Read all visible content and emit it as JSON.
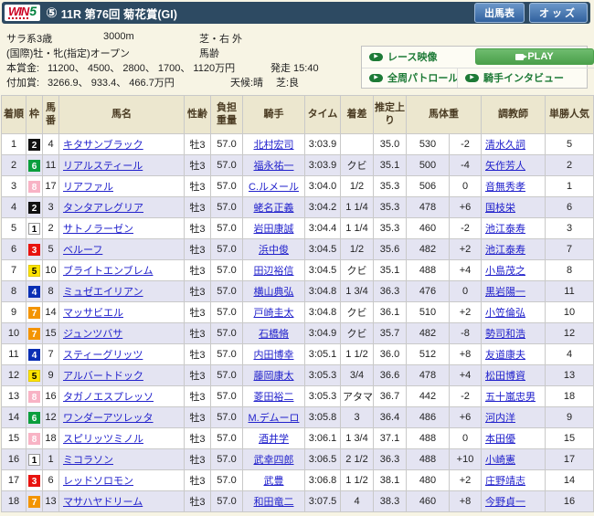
{
  "header": {
    "win5_w": "WIN",
    "win5_5": "5",
    "race_badge": "⑤",
    "title": "11R 第76回 菊花賞(GI)",
    "entries_button": "出馬表",
    "odds_button": "オッズ"
  },
  "race_info": {
    "class": "サラ系3歳",
    "distance": "3000m",
    "course": "芝・右 外",
    "conditions": "(国際)牡・牝(指定)オープン",
    "age_rule": "馬齢",
    "prize_label": "本賞金:",
    "prize_values": "11200、 4500、 2800、 1700、 1120万円",
    "start_time": "発走 15:40",
    "added_label": "付加賞:",
    "added_values": "3266.9、 933.4、 466.7万円",
    "weather": "天候:晴",
    "turf_condition": "芝:良"
  },
  "media": {
    "race_video_label": "レース映像",
    "play_label": "PLAY",
    "patrol_label": "全周パトロール",
    "interview_label": "騎手インタビュー",
    "link_green": "#1d7a36",
    "play_green": "#4ba04b"
  },
  "table": {
    "headers": {
      "rank": "着順",
      "frame": "枠",
      "number": "馬番",
      "name": "馬名",
      "sex_age": "性齢",
      "load": "負担重量",
      "jockey": "騎手",
      "time": "タイム",
      "margin": "着差",
      "last3f": "推定上り",
      "horse_weight": "馬体重",
      "trainer": "調教師",
      "popularity": "単勝人気"
    },
    "rows": [
      {
        "rank": "1",
        "frame": "2",
        "number": "4",
        "name": "キタサンブラック",
        "sex_age": "牡3",
        "load": "57.0",
        "jockey": "北村宏司",
        "time": "3:03.9",
        "margin": "",
        "last3f": "35.0",
        "horse_weight": "530",
        "weight_diff": "-2",
        "trainer": "清水久詞",
        "popularity": "5"
      },
      {
        "rank": "2",
        "frame": "6",
        "number": "11",
        "name": "リアルスティール",
        "sex_age": "牡3",
        "load": "57.0",
        "jockey": "福永祐一",
        "time": "3:03.9",
        "margin": "クビ",
        "last3f": "35.1",
        "horse_weight": "500",
        "weight_diff": "-4",
        "trainer": "矢作芳人",
        "popularity": "2"
      },
      {
        "rank": "3",
        "frame": "8",
        "number": "17",
        "name": "リアファル",
        "sex_age": "牡3",
        "load": "57.0",
        "jockey": "C.ルメール",
        "time": "3:04.0",
        "margin": "1/2",
        "last3f": "35.3",
        "horse_weight": "506",
        "weight_diff": "0",
        "trainer": "音無秀孝",
        "popularity": "1"
      },
      {
        "rank": "4",
        "frame": "2",
        "number": "3",
        "name": "タンタアレグリア",
        "sex_age": "牡3",
        "load": "57.0",
        "jockey": "蛯名正義",
        "time": "3:04.2",
        "margin": "1 1/4",
        "last3f": "35.3",
        "horse_weight": "478",
        "weight_diff": "+6",
        "trainer": "国枝栄",
        "popularity": "6"
      },
      {
        "rank": "5",
        "frame": "1",
        "number": "2",
        "name": "サトノラーゼン",
        "sex_age": "牡3",
        "load": "57.0",
        "jockey": "岩田康誠",
        "time": "3:04.4",
        "margin": "1 1/4",
        "last3f": "35.3",
        "horse_weight": "460",
        "weight_diff": "-2",
        "trainer": "池江泰寿",
        "popularity": "3"
      },
      {
        "rank": "6",
        "frame": "3",
        "number": "5",
        "name": "ベルーフ",
        "sex_age": "牡3",
        "load": "57.0",
        "jockey": "浜中俊",
        "time": "3:04.5",
        "margin": "1/2",
        "last3f": "35.6",
        "horse_weight": "482",
        "weight_diff": "+2",
        "trainer": "池江泰寿",
        "popularity": "7"
      },
      {
        "rank": "7",
        "frame": "5",
        "number": "10",
        "name": "ブライトエンブレム",
        "sex_age": "牡3",
        "load": "57.0",
        "jockey": "田辺裕信",
        "time": "3:04.5",
        "margin": "クビ",
        "last3f": "35.1",
        "horse_weight": "488",
        "weight_diff": "+4",
        "trainer": "小島茂之",
        "popularity": "8"
      },
      {
        "rank": "8",
        "frame": "4",
        "number": "8",
        "name": "ミュゼエイリアン",
        "sex_age": "牡3",
        "load": "57.0",
        "jockey": "横山典弘",
        "time": "3:04.8",
        "margin": "1 3/4",
        "last3f": "36.3",
        "horse_weight": "476",
        "weight_diff": "0",
        "trainer": "黒岩陽一",
        "popularity": "11"
      },
      {
        "rank": "9",
        "frame": "7",
        "number": "14",
        "name": "マッサビエル",
        "sex_age": "牡3",
        "load": "57.0",
        "jockey": "戸崎圭太",
        "time": "3:04.8",
        "margin": "クビ",
        "last3f": "36.1",
        "horse_weight": "510",
        "weight_diff": "+2",
        "trainer": "小笠倫弘",
        "popularity": "10"
      },
      {
        "rank": "10",
        "frame": "7",
        "number": "15",
        "name": "ジュンツバサ",
        "sex_age": "牡3",
        "load": "57.0",
        "jockey": "石橋脩",
        "time": "3:04.9",
        "margin": "クビ",
        "last3f": "35.7",
        "horse_weight": "482",
        "weight_diff": "-8",
        "trainer": "勢司和浩",
        "popularity": "12"
      },
      {
        "rank": "11",
        "frame": "4",
        "number": "7",
        "name": "スティーグリッツ",
        "sex_age": "牡3",
        "load": "57.0",
        "jockey": "内田博幸",
        "time": "3:05.1",
        "margin": "1 1/2",
        "last3f": "36.0",
        "horse_weight": "512",
        "weight_diff": "+8",
        "trainer": "友道康夫",
        "popularity": "4"
      },
      {
        "rank": "12",
        "frame": "5",
        "number": "9",
        "name": "アルバートドック",
        "sex_age": "牡3",
        "load": "57.0",
        "jockey": "藤岡康太",
        "time": "3:05.3",
        "margin": "3/4",
        "last3f": "36.6",
        "horse_weight": "478",
        "weight_diff": "+4",
        "trainer": "松田博資",
        "popularity": "13"
      },
      {
        "rank": "13",
        "frame": "8",
        "number": "16",
        "name": "タガノエスプレッソ",
        "sex_age": "牡3",
        "load": "57.0",
        "jockey": "菱田裕二",
        "time": "3:05.3",
        "margin": "アタマ",
        "last3f": "36.7",
        "horse_weight": "442",
        "weight_diff": "-2",
        "trainer": "五十嵐忠男",
        "popularity": "18"
      },
      {
        "rank": "14",
        "frame": "6",
        "number": "12",
        "name": "ワンダーアツレッタ",
        "sex_age": "牡3",
        "load": "57.0",
        "jockey": "M.デムーロ",
        "time": "3:05.8",
        "margin": "3",
        "last3f": "36.4",
        "horse_weight": "486",
        "weight_diff": "+6",
        "trainer": "河内洋",
        "popularity": "9"
      },
      {
        "rank": "15",
        "frame": "8",
        "number": "18",
        "name": "スピリッツミノル",
        "sex_age": "牡3",
        "load": "57.0",
        "jockey": "酒井学",
        "time": "3:06.1",
        "margin": "1 3/4",
        "last3f": "37.1",
        "horse_weight": "488",
        "weight_diff": "0",
        "trainer": "本田優",
        "popularity": "15"
      },
      {
        "rank": "16",
        "frame": "1",
        "number": "1",
        "name": "ミコラソン",
        "sex_age": "牡3",
        "load": "57.0",
        "jockey": "武幸四郎",
        "time": "3:06.5",
        "margin": "2 1/2",
        "last3f": "36.3",
        "horse_weight": "488",
        "weight_diff": "+10",
        "trainer": "小崎憲",
        "popularity": "17"
      },
      {
        "rank": "17",
        "frame": "3",
        "number": "6",
        "name": "レッドソロモン",
        "sex_age": "牡3",
        "load": "57.0",
        "jockey": "武豊",
        "time": "3:06.8",
        "margin": "1 1/2",
        "last3f": "38.1",
        "horse_weight": "480",
        "weight_diff": "+2",
        "trainer": "庄野靖志",
        "popularity": "14"
      },
      {
        "rank": "18",
        "frame": "7",
        "number": "13",
        "name": "マサハヤドリーム",
        "sex_age": "牡3",
        "load": "57.0",
        "jockey": "和田竜二",
        "time": "3:07.5",
        "margin": "4",
        "last3f": "38.3",
        "horse_weight": "460",
        "weight_diff": "+8",
        "trainer": "今野貞一",
        "popularity": "16"
      }
    ]
  },
  "frame_colors": {
    "1": {
      "bg": "#ffffff",
      "fg": "#000000",
      "border": "#999999"
    },
    "2": {
      "bg": "#111111",
      "fg": "#ffffff",
      "border": "#111111"
    },
    "3": {
      "bg": "#e8120e",
      "fg": "#ffffff",
      "border": "#e8120e"
    },
    "4": {
      "bg": "#0a2fb4",
      "fg": "#ffffff",
      "border": "#0a2fb4"
    },
    "5": {
      "bg": "#ffe400",
      "fg": "#000000",
      "border": "#e0c800"
    },
    "6": {
      "bg": "#0b9e3d",
      "fg": "#ffffff",
      "border": "#0b9e3d"
    },
    "7": {
      "bg": "#f39400",
      "fg": "#ffffff",
      "border": "#f39400"
    },
    "8": {
      "bg": "#f8b3c5",
      "fg": "#ffffff",
      "border": "#f8b3c5"
    }
  }
}
